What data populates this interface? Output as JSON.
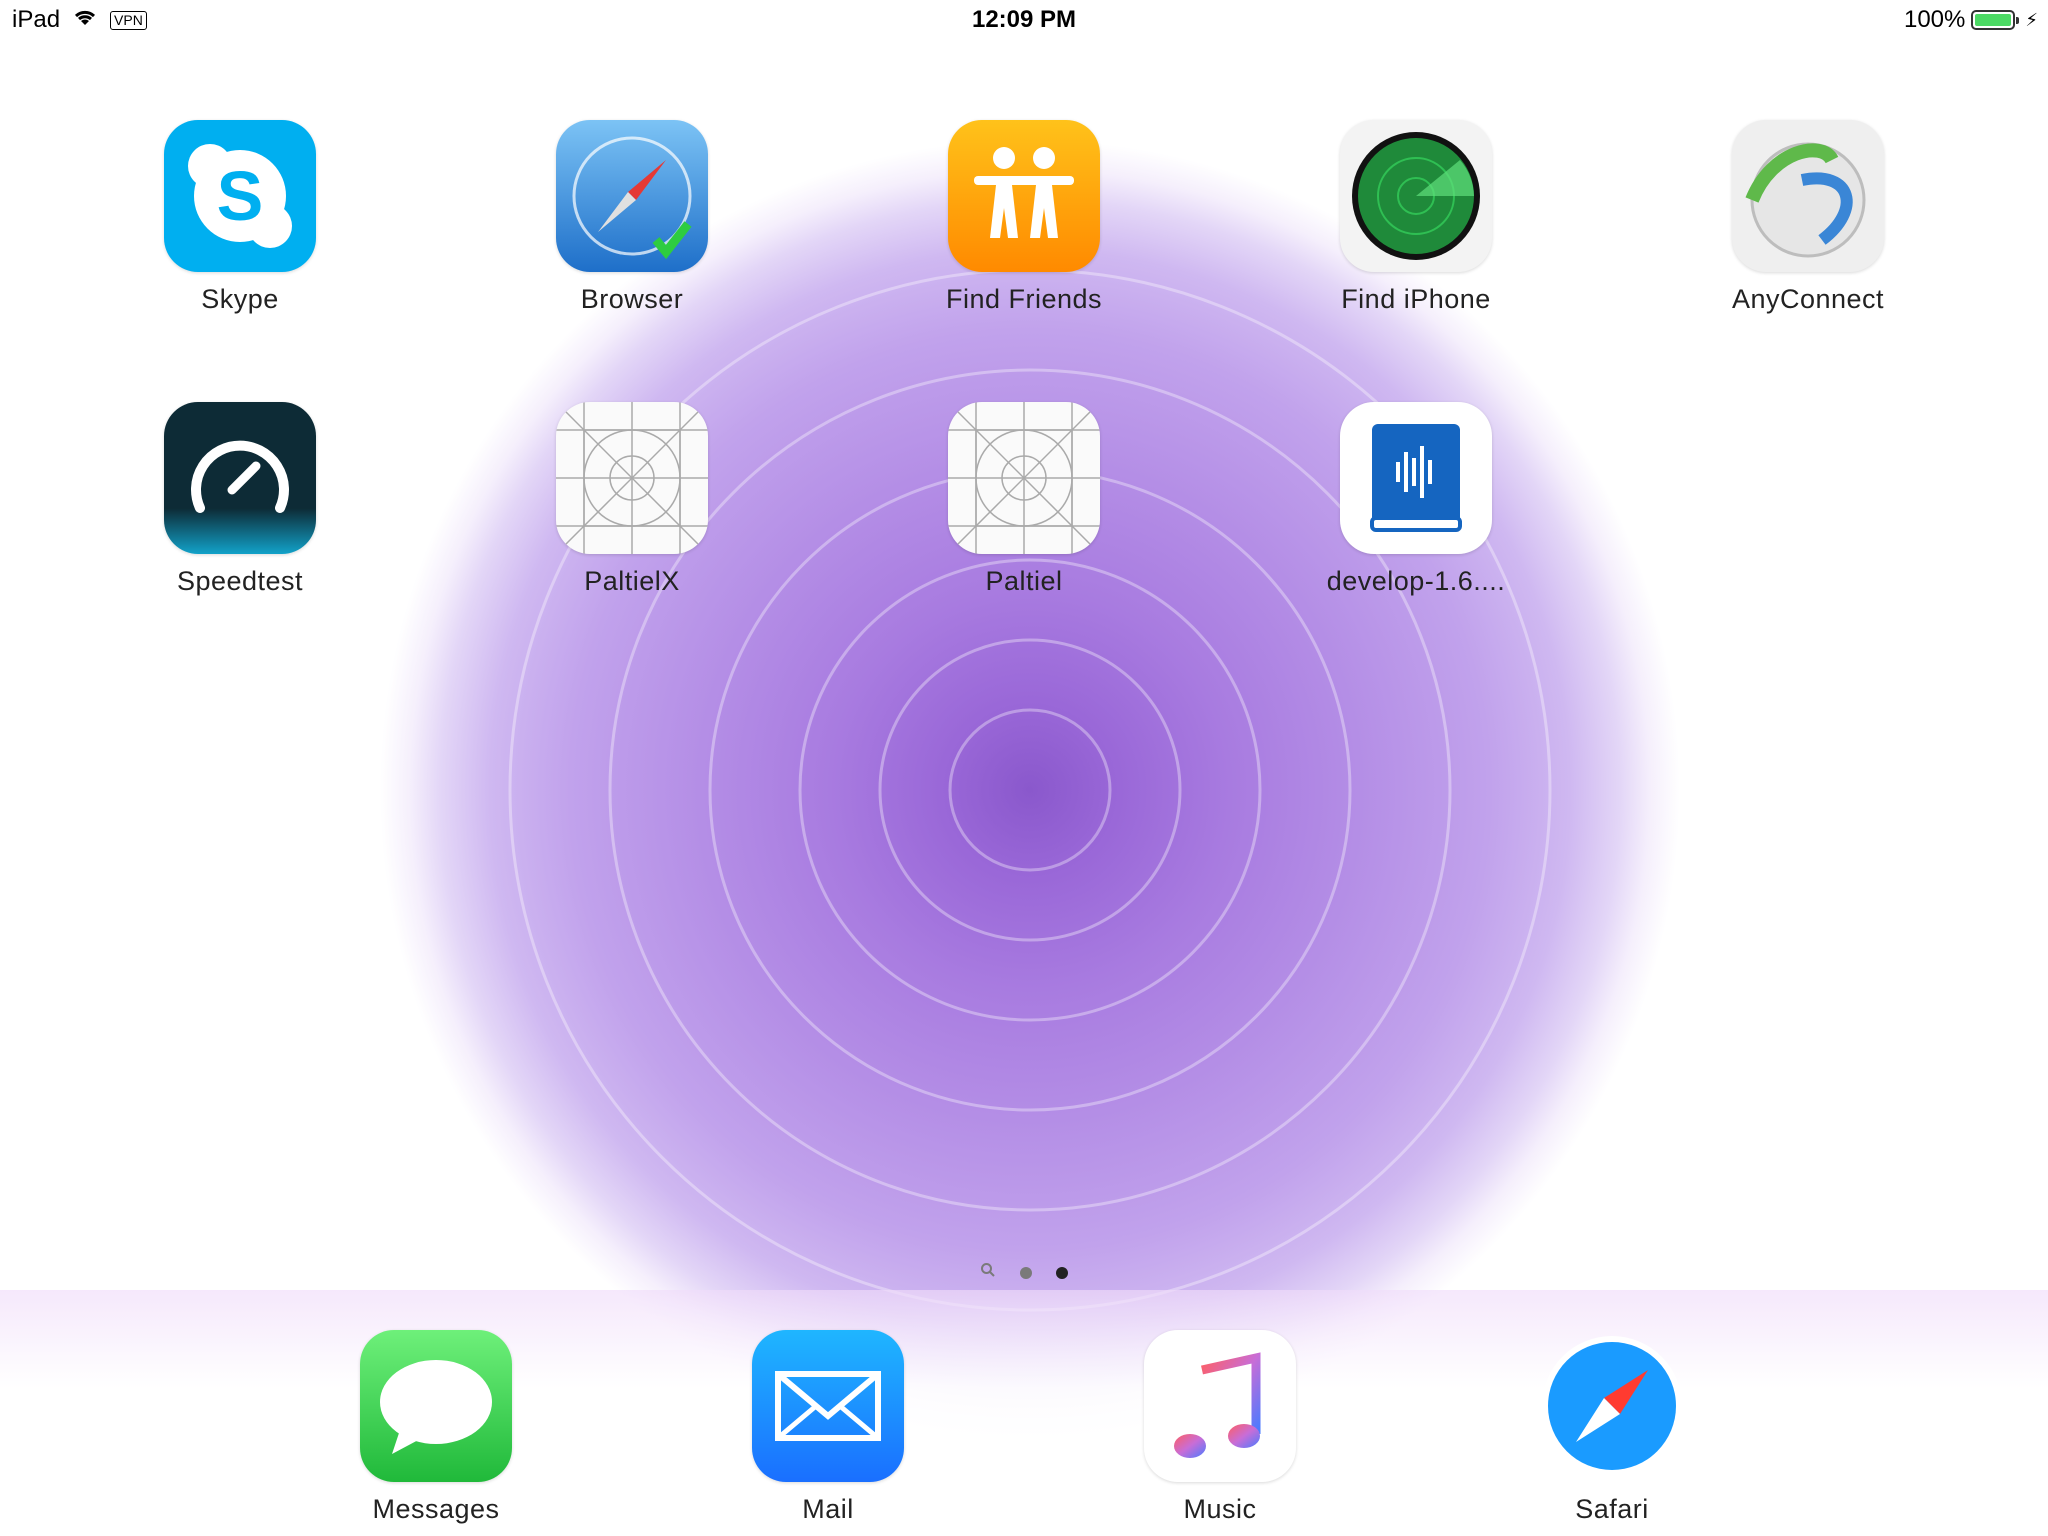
{
  "status_bar": {
    "device": "iPad",
    "vpn": "VPN",
    "time": "12:09 PM",
    "battery_percent": "100%",
    "battery_level": 1.0
  },
  "apps": [
    {
      "label": "Skype",
      "icon": "skype-icon"
    },
    {
      "label": "Browser",
      "icon": "browser-compass-icon"
    },
    {
      "label": "Find Friends",
      "icon": "find-friends-icon"
    },
    {
      "label": "Find iPhone",
      "icon": "find-iphone-radar-icon"
    },
    {
      "label": "AnyConnect",
      "icon": "anyconnect-icon"
    },
    {
      "label": "Speedtest",
      "icon": "speedtest-gauge-icon"
    },
    {
      "label": "PaltielX",
      "icon": "placeholder-grid-icon"
    },
    {
      "label": "Paltiel",
      "icon": "placeholder-grid-icon"
    },
    {
      "label": "develop-1.6....",
      "icon": "book-icon"
    }
  ],
  "page_indicator": {
    "pages": 3,
    "current": 3
  },
  "dock": [
    {
      "label": "Messages",
      "icon": "messages-bubble-icon"
    },
    {
      "label": "Mail",
      "icon": "mail-envelope-icon"
    },
    {
      "label": "Music",
      "icon": "music-note-icon"
    },
    {
      "label": "Safari",
      "icon": "safari-compass-icon"
    }
  ],
  "colors": {
    "wallpaper_flower": "#9a68d8",
    "skype_blue": "#00aff0",
    "find_friends_orange": "#ff9500",
    "battery_green": "#4cd964",
    "messages_green": "#34c759",
    "mail_blue": "#1a8cff"
  }
}
